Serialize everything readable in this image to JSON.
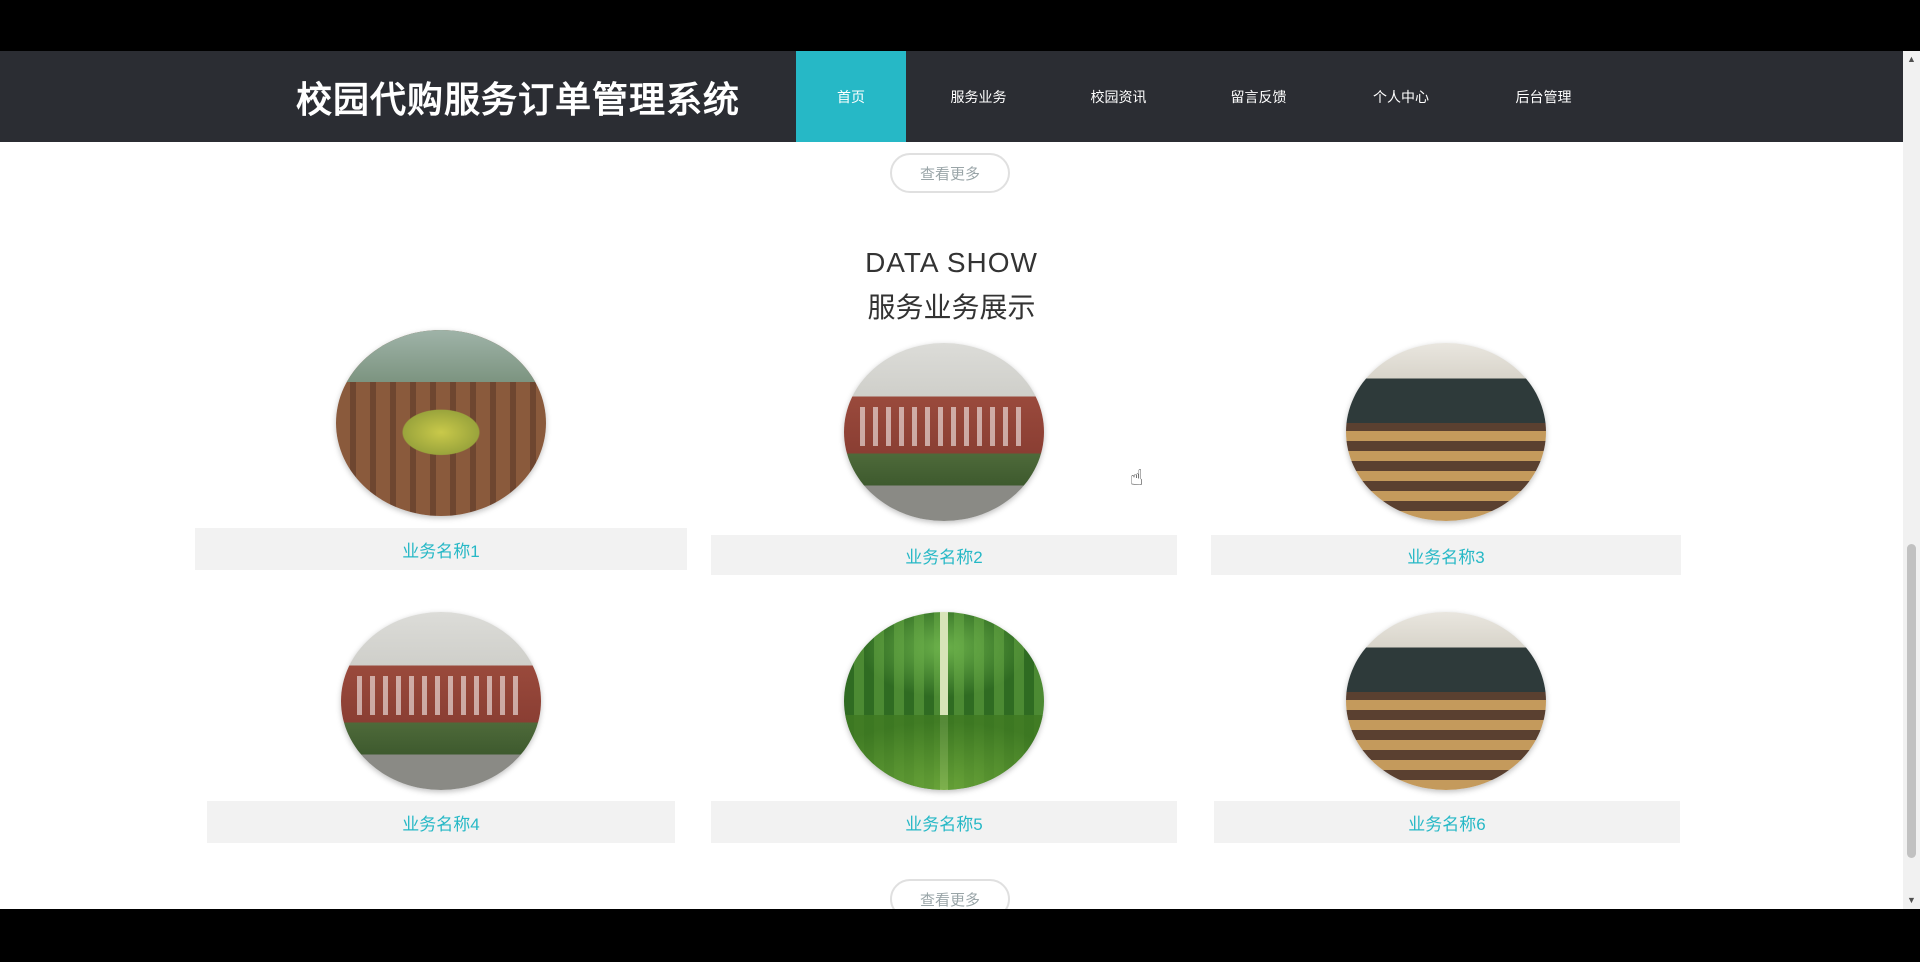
{
  "header": {
    "site_title": "校园代购服务订单管理系统",
    "nav": [
      {
        "label": "首页",
        "active": true
      },
      {
        "label": "服务业务",
        "active": false
      },
      {
        "label": "校园资讯",
        "active": false
      },
      {
        "label": "留言反馈",
        "active": false
      },
      {
        "label": "个人中心",
        "active": false
      },
      {
        "label": "后台管理",
        "active": false
      }
    ]
  },
  "main": {
    "top_button_label": "查看更多",
    "section_title_en": "DATA SHOW",
    "section_title_cn": "服务业务展示",
    "cards": [
      {
        "label": "业务名称1",
        "image": "campus-aerial"
      },
      {
        "label": "业务名称2",
        "image": "campus-building"
      },
      {
        "label": "业务名称3",
        "image": "classroom"
      },
      {
        "label": "业务名称4",
        "image": "campus-building"
      },
      {
        "label": "业务名称5",
        "image": "forest-path"
      },
      {
        "label": "业务名称6",
        "image": "classroom"
      }
    ],
    "bottom_button_label": "查看更多"
  },
  "colors": {
    "header_bg": "#2b2d33",
    "accent": "#26b8c6",
    "label_bg": "#f2f2f2"
  }
}
